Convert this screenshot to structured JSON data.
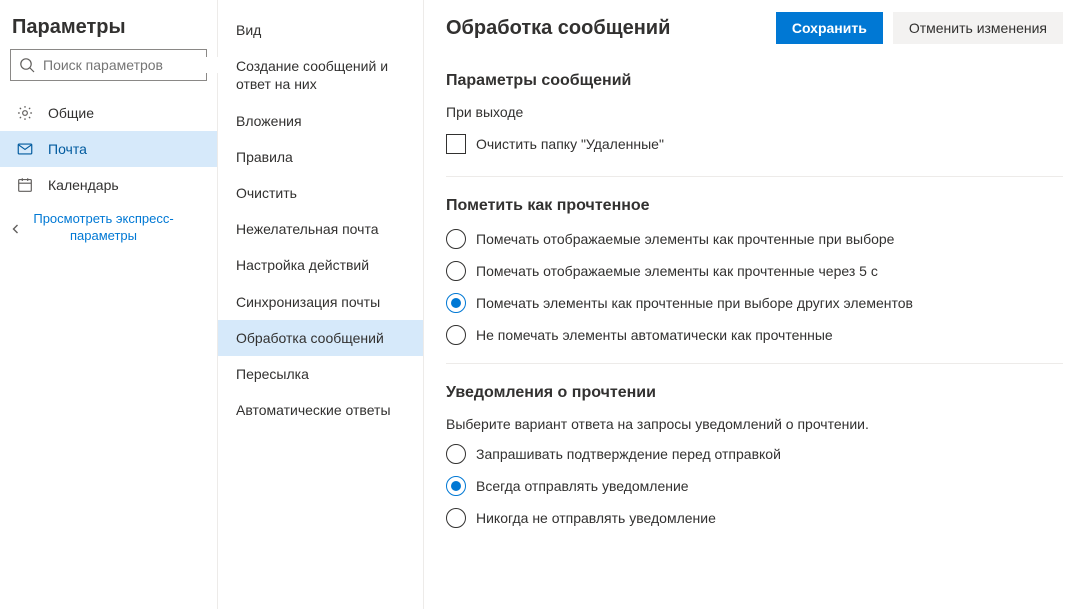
{
  "sidebar": {
    "title": "Параметры",
    "search_placeholder": "Поиск параметров",
    "items": [
      {
        "label": "Общие",
        "icon": "gear"
      },
      {
        "label": "Почта",
        "icon": "mail",
        "selected": true
      },
      {
        "label": "Календарь",
        "icon": "calendar"
      }
    ],
    "quick_link": "Просмотреть экспресс-параметры"
  },
  "subnav": {
    "items": [
      {
        "label": "Вид"
      },
      {
        "label": "Создание сообщений и ответ на них"
      },
      {
        "label": "Вложения"
      },
      {
        "label": "Правила"
      },
      {
        "label": "Очистить"
      },
      {
        "label": "Нежелательная почта"
      },
      {
        "label": "Настройка действий"
      },
      {
        "label": "Синхронизация почты"
      },
      {
        "label": "Обработка сообщений",
        "selected": true
      },
      {
        "label": "Пересылка"
      },
      {
        "label": "Автоматические ответы"
      }
    ]
  },
  "main": {
    "title": "Обработка сообщений",
    "save_label": "Сохранить",
    "cancel_label": "Отменить изменения",
    "section_message_options": {
      "title": "Параметры сообщений",
      "on_exit": "При выходе",
      "clear_deleted": "Очистить папку \"Удаленные\"",
      "clear_deleted_checked": false
    },
    "section_mark_read": {
      "title": "Пометить как прочтенное",
      "options": [
        {
          "label": "Помечать отображаемые элементы как прочтенные при выборе",
          "checked": false
        },
        {
          "label": "Помечать отображаемые элементы как прочтенные через 5 с",
          "checked": false
        },
        {
          "label": "Помечать элементы как прочтенные при выборе других элементов",
          "checked": true
        },
        {
          "label": "Не помечать элементы автоматически как прочтенные",
          "checked": false
        }
      ]
    },
    "section_read_receipts": {
      "title": "Уведомления о прочтении",
      "description": "Выберите вариант ответа на запросы уведомлений о прочтении.",
      "options": [
        {
          "label": "Запрашивать подтверждение перед отправкой",
          "checked": false
        },
        {
          "label": "Всегда отправлять уведомление",
          "checked": true
        },
        {
          "label": "Никогда не отправлять уведомление",
          "checked": false
        }
      ]
    }
  }
}
